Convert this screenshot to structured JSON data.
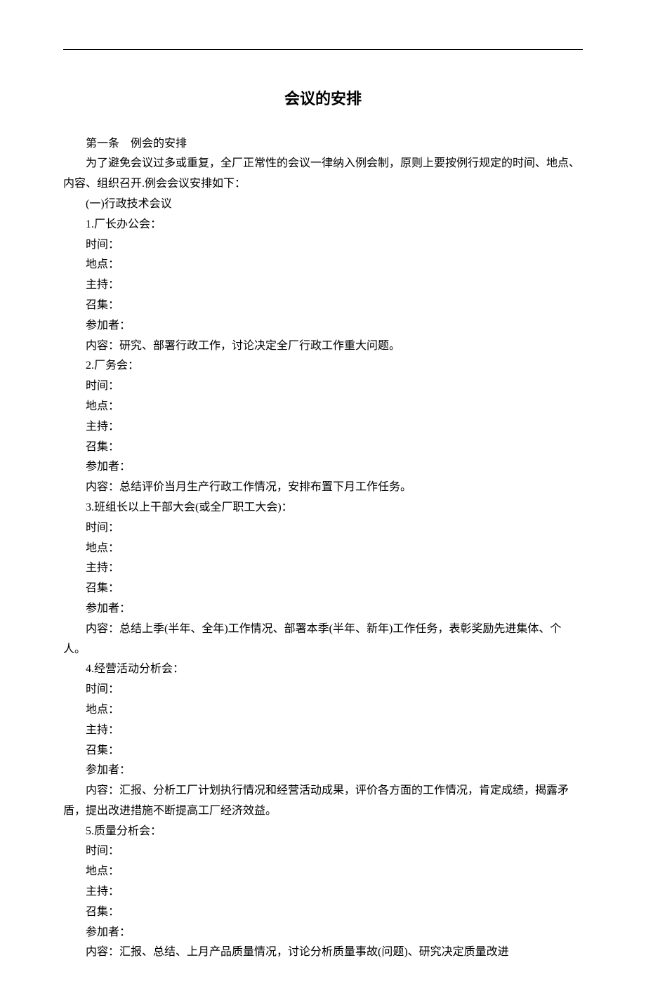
{
  "title": "会议的安排",
  "article1": {
    "heading": "第一条　例会的安排",
    "intro": "为了避免会议过多或重复，全厂正常性的会议一律纳入例会制，原则上要按例行规定的时间、地点、内容、组织召开.例会会议安排如下：",
    "section_heading": "(一)行政技术会议",
    "meetings": [
      {
        "num": "1.厂长办公会：",
        "time": "时间：",
        "place": "地点：",
        "host": "主持：",
        "convene": "召集：",
        "attendees": "参加者：",
        "content": "内容：研究、部署行政工作，讨论决定全厂行政工作重大问题。"
      },
      {
        "num": "2.厂务会：",
        "time": "时间：",
        "place": "地点：",
        "host": "主持：",
        "convene": "召集：",
        "attendees": "参加者：",
        "content": "内容：总结评价当月生产行政工作情况，安排布置下月工作任务。"
      },
      {
        "num": "3.班组长以上干部大会(或全厂职工大会)：",
        "time": "时间：",
        "place": "地点：",
        "host": "主持：",
        "convene": "召集：",
        "attendees": "参加者：",
        "content": "内容：总结上季(半年、全年)工作情况、部署本季(半年、新年)工作任务，表彰奖励先进集体、个人。"
      },
      {
        "num": "4.经营活动分析会：",
        "time": "时间：",
        "place": "地点：",
        "host": "主持：",
        "convene": "召集：",
        "attendees": "参加者：",
        "content": "内容：汇报、分析工厂计划执行情况和经营活动成果，评价各方面的工作情况，肯定成绩，揭露矛盾，提出改进措施不断提高工厂经济效益。"
      },
      {
        "num": "5.质量分析会：",
        "time": "时间：",
        "place": "地点：",
        "host": "主持：",
        "convene": "召集：",
        "attendees": "参加者：",
        "content": "内容：汇报、总结、上月产品质量情况，讨论分析质量事故(问题)、研究决定质量改进"
      }
    ]
  }
}
